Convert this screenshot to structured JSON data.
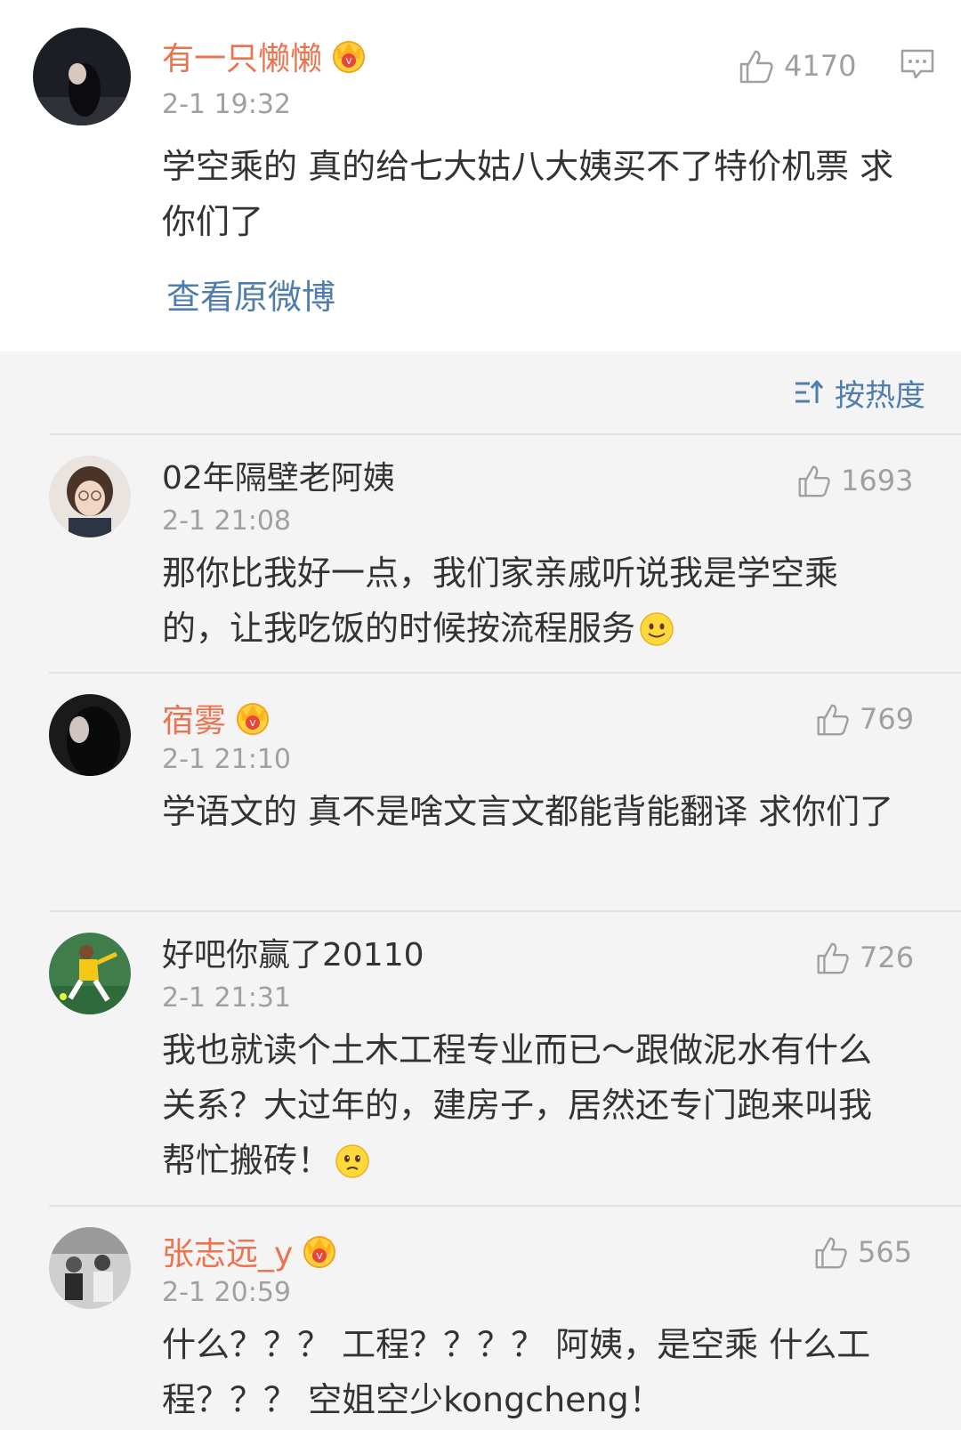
{
  "main_comment": {
    "username": "有一只懒懒",
    "timestamp": "2-1 19:32",
    "likes": "4170",
    "content": "学空乘的 真的给七大姑八大姨买不了特价机票 求你们了",
    "view_original_label": "查看原微博",
    "vip": true
  },
  "sort": {
    "label": "按热度",
    "icon": "sort-icon"
  },
  "replies": [
    {
      "username": "02年隔壁老阿姨",
      "timestamp": "2-1 21:08",
      "likes": "1693",
      "content": "那你比我好一点，我们家亲戚听说我是学空乘的，让我吃饭的时候按流程服务",
      "emoji": "smile-emoji",
      "vip": false
    },
    {
      "username": "宿雾",
      "timestamp": "2-1 21:10",
      "likes": "769",
      "content": "学语文的 真不是啥文言文都能背能翻译 求你们了",
      "vip": true
    },
    {
      "username": "好吧你赢了20110",
      "timestamp": "2-1 21:31",
      "likes": "726",
      "content": "我也就读个土木工程专业而已～跟做泥水有什么关系？大过年的，建房子，居然还专门跑来叫我帮忙搬砖！",
      "emoji": "sad-emoji",
      "vip": false
    },
    {
      "username": "张志远_y",
      "timestamp": "2-1 20:59",
      "likes": "565",
      "content": "什么？？？ 工程？？？？ 阿姨，是空乘 什么工程？？？ 空姐空少kongcheng！",
      "vip": true
    }
  ],
  "colors": {
    "vip_name": "#eb7350",
    "link": "#507daf",
    "meta": "#a0a0a0"
  }
}
